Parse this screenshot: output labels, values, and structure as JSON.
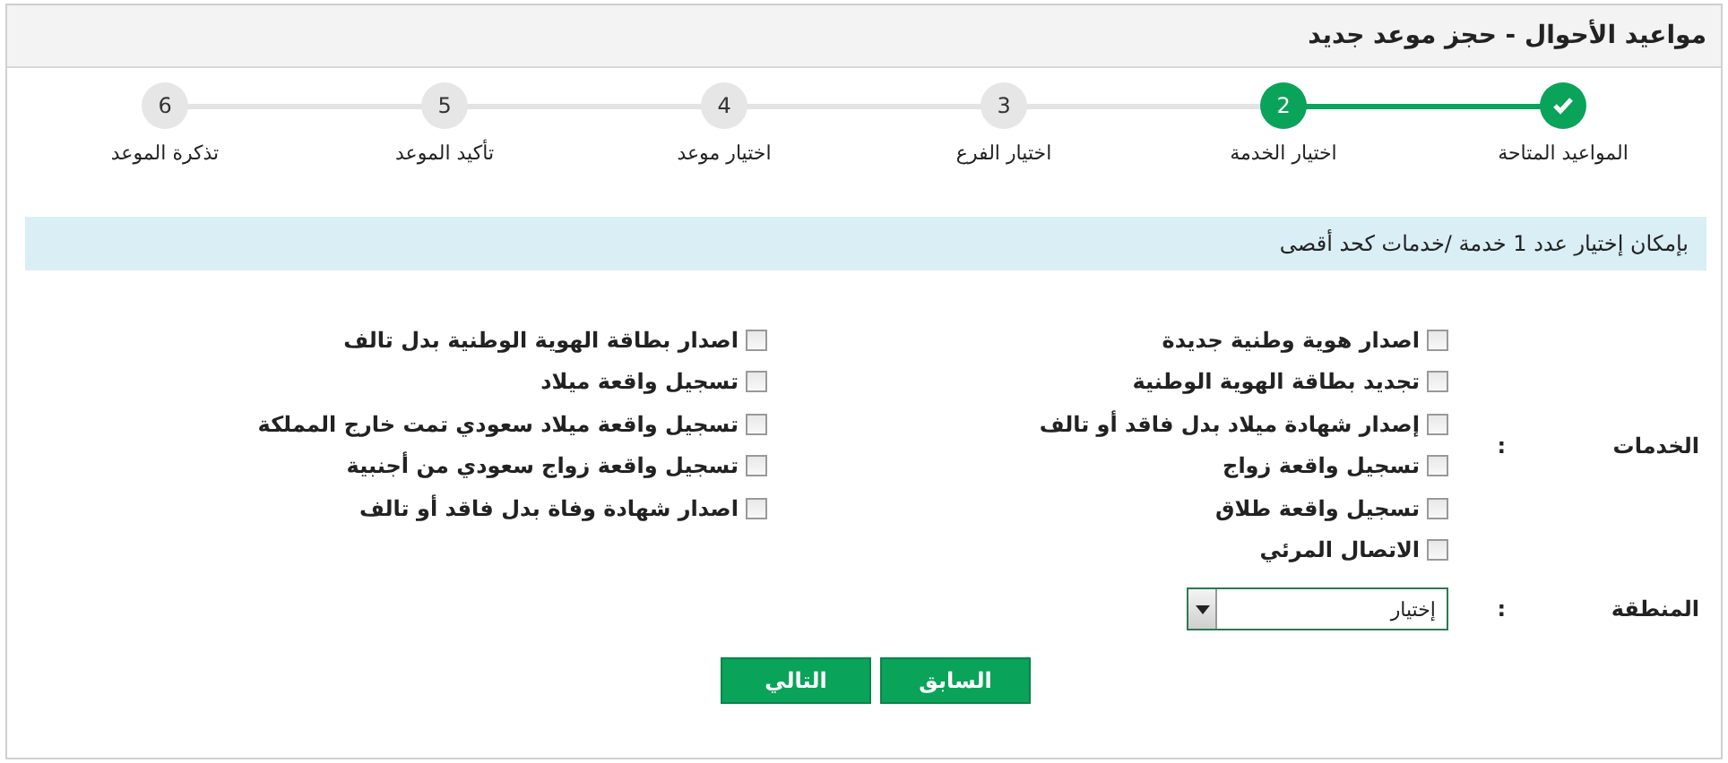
{
  "window": {
    "title": "مواعيد الأحوال - حجز موعد جديد"
  },
  "steps": [
    {
      "label": "المواعيد المتاحة",
      "kind": "done"
    },
    {
      "number": "2",
      "label": "اختيار الخدمة",
      "kind": "current"
    },
    {
      "number": "3",
      "label": "اختيار الفرع",
      "kind": "pending"
    },
    {
      "number": "4",
      "label": "اختيار موعد",
      "kind": "pending"
    },
    {
      "number": "5",
      "label": "تأكيد الموعد",
      "kind": "pending"
    },
    {
      "number": "6",
      "label": "تذكرة الموعد",
      "kind": "pending"
    }
  ],
  "notice": "بإمكان إختيار عدد 1 خدمة /خدمات كحد أقصى",
  "services": {
    "label": "الخدمات",
    "separator": ":",
    "columns": [
      [
        {
          "label": "اصدار هوية وطنية جديدة",
          "checked": false
        },
        {
          "label": "تجديد بطاقة الهوية الوطنية",
          "checked": false
        },
        {
          "label": "إصدار شهادة ميلاد بدل فاقد أو تالف",
          "checked": false
        },
        {
          "label": "تسجيل واقعة زواج",
          "checked": false
        },
        {
          "label": "تسجيل واقعة طلاق",
          "checked": false
        },
        {
          "label": "الاتصال المرئي",
          "checked": false
        }
      ],
      [
        {
          "label": "اصدار بطاقة الهوية الوطنية بدل تالف",
          "checked": false
        },
        {
          "label": "تسجيل واقعة ميلاد",
          "checked": false
        },
        {
          "label": "تسجيل واقعة ميلاد سعودي تمت خارج المملكة",
          "checked": false
        },
        {
          "label": "تسجيل واقعة زواج سعودي من أجنبية",
          "checked": false
        },
        {
          "label": "اصدار شهادة وفاة بدل فاقد أو تالف",
          "checked": false
        }
      ]
    ]
  },
  "region": {
    "label": "المنطقة",
    "separator": ":",
    "value": "إختيار"
  },
  "buttons": [
    {
      "label": "السابق"
    },
    {
      "label": "التالي"
    }
  ]
}
